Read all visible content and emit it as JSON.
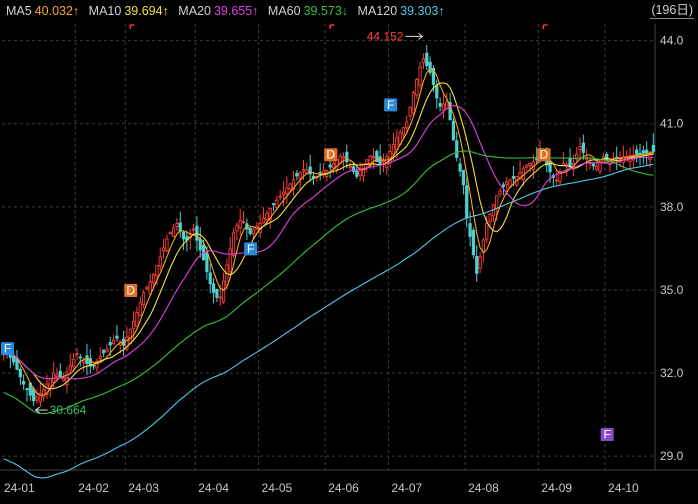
{
  "legend": {
    "items": [
      {
        "label": "MA5",
        "value": "40.032↑",
        "color": "#f5a623"
      },
      {
        "label": "MA10",
        "value": "39.694↑",
        "color": "#f0e040"
      },
      {
        "label": "MA20",
        "value": "39.655↑",
        "color": "#e040e0"
      },
      {
        "label": "MA60",
        "value": "39.573↓",
        "color": "#34c03c"
      },
      {
        "label": "MA120",
        "value": "39.303↑",
        "color": "#4fc8e6"
      }
    ],
    "period_button": "(196日)"
  },
  "colors": {
    "up": "#ff3b3b",
    "down": "#4fd0d0",
    "grid": "#3a3a3a",
    "max_label": "#ff4040",
    "min_label": "#36c060"
  },
  "chart_data": {
    "type": "candlestick",
    "ylim": [
      28.5,
      44.6
    ],
    "yticks": [
      "44.0",
      "41.0",
      "38.0",
      "35.0",
      "32.0",
      "29.0"
    ],
    "xticks": [
      "24-01",
      "24-02",
      "24-03",
      "24-04",
      "24-05",
      "24-06",
      "24-07",
      "24-08",
      "24-09",
      "24-10"
    ],
    "months": [
      {
        "label": "24-01",
        "days": 22,
        "close": [
          32.9,
          32.4,
          31.6,
          31.0,
          31.4,
          32.0,
          31.8,
          32.5
        ]
      },
      {
        "label": "24-02",
        "days": 15,
        "close": [
          32.7,
          32.4,
          32.2,
          32.6,
          32.9,
          33.3,
          33.0
        ]
      },
      {
        "label": "24-03",
        "days": 21,
        "close": [
          33.3,
          34.0,
          34.9,
          35.4,
          36.2,
          37.0,
          37.4,
          36.7,
          37.2
        ]
      },
      {
        "label": "24-04",
        "days": 19,
        "close": [
          36.8,
          36.0,
          35.0,
          34.6,
          35.9,
          37.2,
          37.6,
          37.0,
          37.3
        ]
      },
      {
        "label": "24-05",
        "days": 20,
        "close": [
          37.4,
          37.9,
          38.3,
          38.7,
          39.1,
          39.4,
          39.0,
          39.3
        ]
      },
      {
        "label": "24-06",
        "days": 19,
        "close": [
          39.3,
          39.6,
          39.9,
          39.5,
          39.1,
          39.6,
          39.9,
          39.5,
          39.8
        ]
      },
      {
        "label": "24-07",
        "days": 23,
        "close": [
          40.0,
          40.6,
          41.0,
          42.3,
          43.4,
          42.8,
          41.6,
          41.8,
          40.0,
          38.8
        ]
      },
      {
        "label": "24-08",
        "days": 22,
        "close": [
          37.6,
          35.6,
          37.4,
          38.4,
          38.9,
          39.1,
          39.5,
          39.7
        ]
      },
      {
        "label": "24-09",
        "days": 20,
        "close": [
          40.1,
          39.4,
          38.9,
          39.6,
          39.4,
          40.2,
          39.7,
          39.4,
          39.8
        ]
      },
      {
        "label": "24-10",
        "days": 15,
        "close": [
          39.7,
          40.0
        ]
      }
    ],
    "annotations": [
      {
        "text": "44.152",
        "value": 44.152,
        "kind": "max"
      },
      {
        "text": "30.664",
        "value": 30.664,
        "kind": "min"
      }
    ],
    "markers": [
      {
        "label": "F",
        "color": "#2a8ad8",
        "month": "24-01",
        "value": 32.9
      },
      {
        "label": "D",
        "color": "#e07020",
        "month": "24-03",
        "value": 35.0
      },
      {
        "label": "F",
        "color": "#2a8ad8",
        "month": "24-04",
        "value": 36.5
      },
      {
        "label": "D",
        "color": "#e07020",
        "month": "24-06",
        "value": 39.9
      },
      {
        "label": "F",
        "color": "#2a8ad8",
        "month": "24-07",
        "value": 41.7
      },
      {
        "label": "D",
        "color": "#e07020",
        "month": "24-09",
        "value": 39.9
      },
      {
        "label": "F",
        "color": "#8a4ad0",
        "month": "24-10",
        "value": 29.8
      }
    ]
  }
}
